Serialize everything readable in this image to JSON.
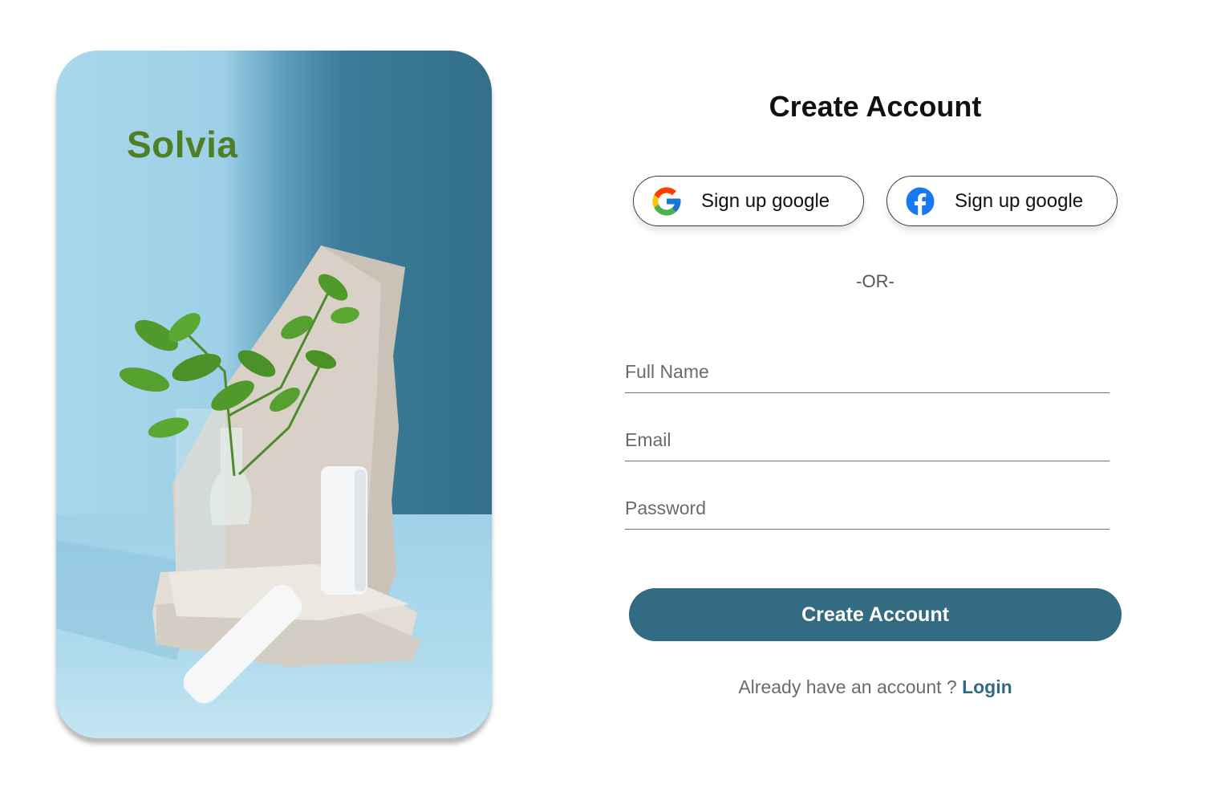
{
  "brand": {
    "name": "Solvia",
    "color": "#4e7f25"
  },
  "form": {
    "title": "Create Account",
    "social": {
      "google_label": "Sign up google",
      "facebook_label": "Sign up google"
    },
    "separator": "-OR-",
    "fields": {
      "full_name": {
        "placeholder": "Full Name",
        "value": ""
      },
      "email": {
        "placeholder": "Email",
        "value": ""
      },
      "password": {
        "placeholder": "Password",
        "value": ""
      }
    },
    "submit_label": "Create Account",
    "footer": {
      "prompt": "Already have an account ? ",
      "login_label": "Login"
    }
  },
  "colors": {
    "primary": "#336b82",
    "link": "#2f6b86",
    "hero_left": "#a9d7eb",
    "hero_right": "#336f8a"
  },
  "icons": [
    "google-icon",
    "facebook-icon"
  ]
}
